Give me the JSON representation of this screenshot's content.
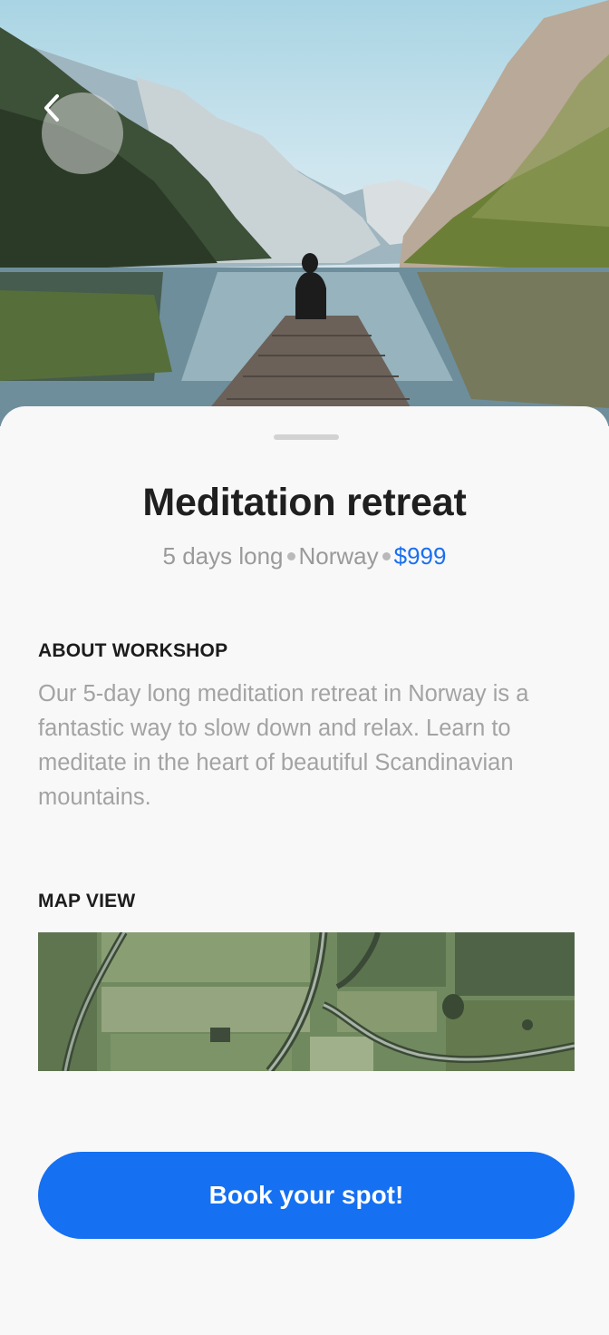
{
  "hero": {
    "image": "mountain-lake-photo",
    "back_icon": "chevron-left-icon"
  },
  "retreat": {
    "title": "Meditation retreat",
    "duration": "5 days long",
    "location": "Norway",
    "price": "$999"
  },
  "about": {
    "heading": "ABOUT WORKSHOP",
    "text": "Our 5-day long meditation retreat in Norway is a fantastic way to slow down and relax. Learn to meditate in the heart of beautiful Scandinavian mountains."
  },
  "map": {
    "heading": "MAP VIEW",
    "image": "aerial-map-photo"
  },
  "cta": {
    "label": "Book your spot!"
  },
  "colors": {
    "accent": "#1570f2",
    "price": "#1a6ff0",
    "background": "#f8f8f8"
  }
}
